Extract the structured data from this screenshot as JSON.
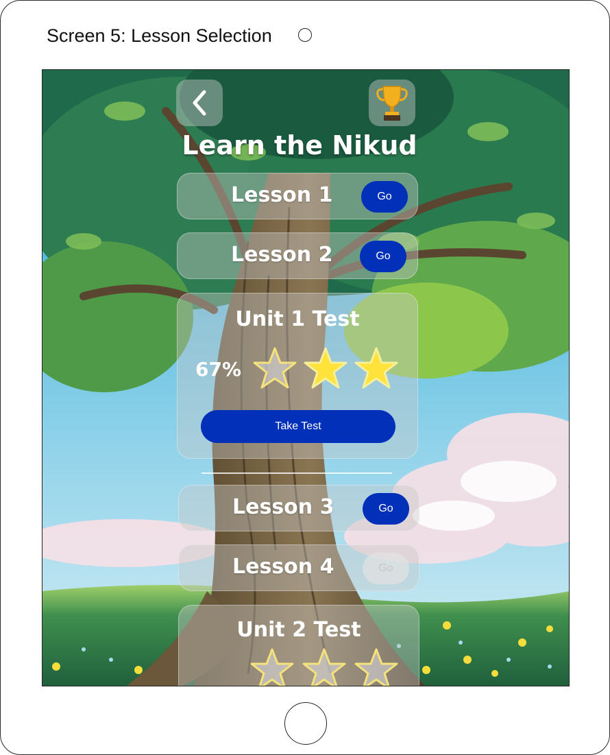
{
  "wireframe": {
    "screen_title": "Screen 5: Lesson Selection"
  },
  "app": {
    "title": "Learn the Nikud",
    "header": {
      "back_icon": "chevron-left-icon",
      "trophy_icon": "trophy-icon"
    },
    "lessons": [
      {
        "label": "Lesson 1",
        "go_label": "Go",
        "enabled": true
      },
      {
        "label": "Lesson 2",
        "go_label": "Go",
        "enabled": true
      },
      {
        "label": "Lesson 3",
        "go_label": "Go",
        "enabled": true
      },
      {
        "label": "Lesson 4",
        "go_label": "Go",
        "enabled": false
      }
    ],
    "unit_tests": [
      {
        "label": "Unit 1 Test",
        "score": "67%",
        "stars_earned": 2,
        "stars_total": 3,
        "button_label": "Take Test"
      },
      {
        "label": "Unit 2 Test",
        "stars_earned": 0,
        "stars_total": 3
      }
    ],
    "colors": {
      "primary_button": "#0330b8",
      "star_filled": "#ffe23a",
      "disabled_button": "#e1e1e1"
    }
  }
}
